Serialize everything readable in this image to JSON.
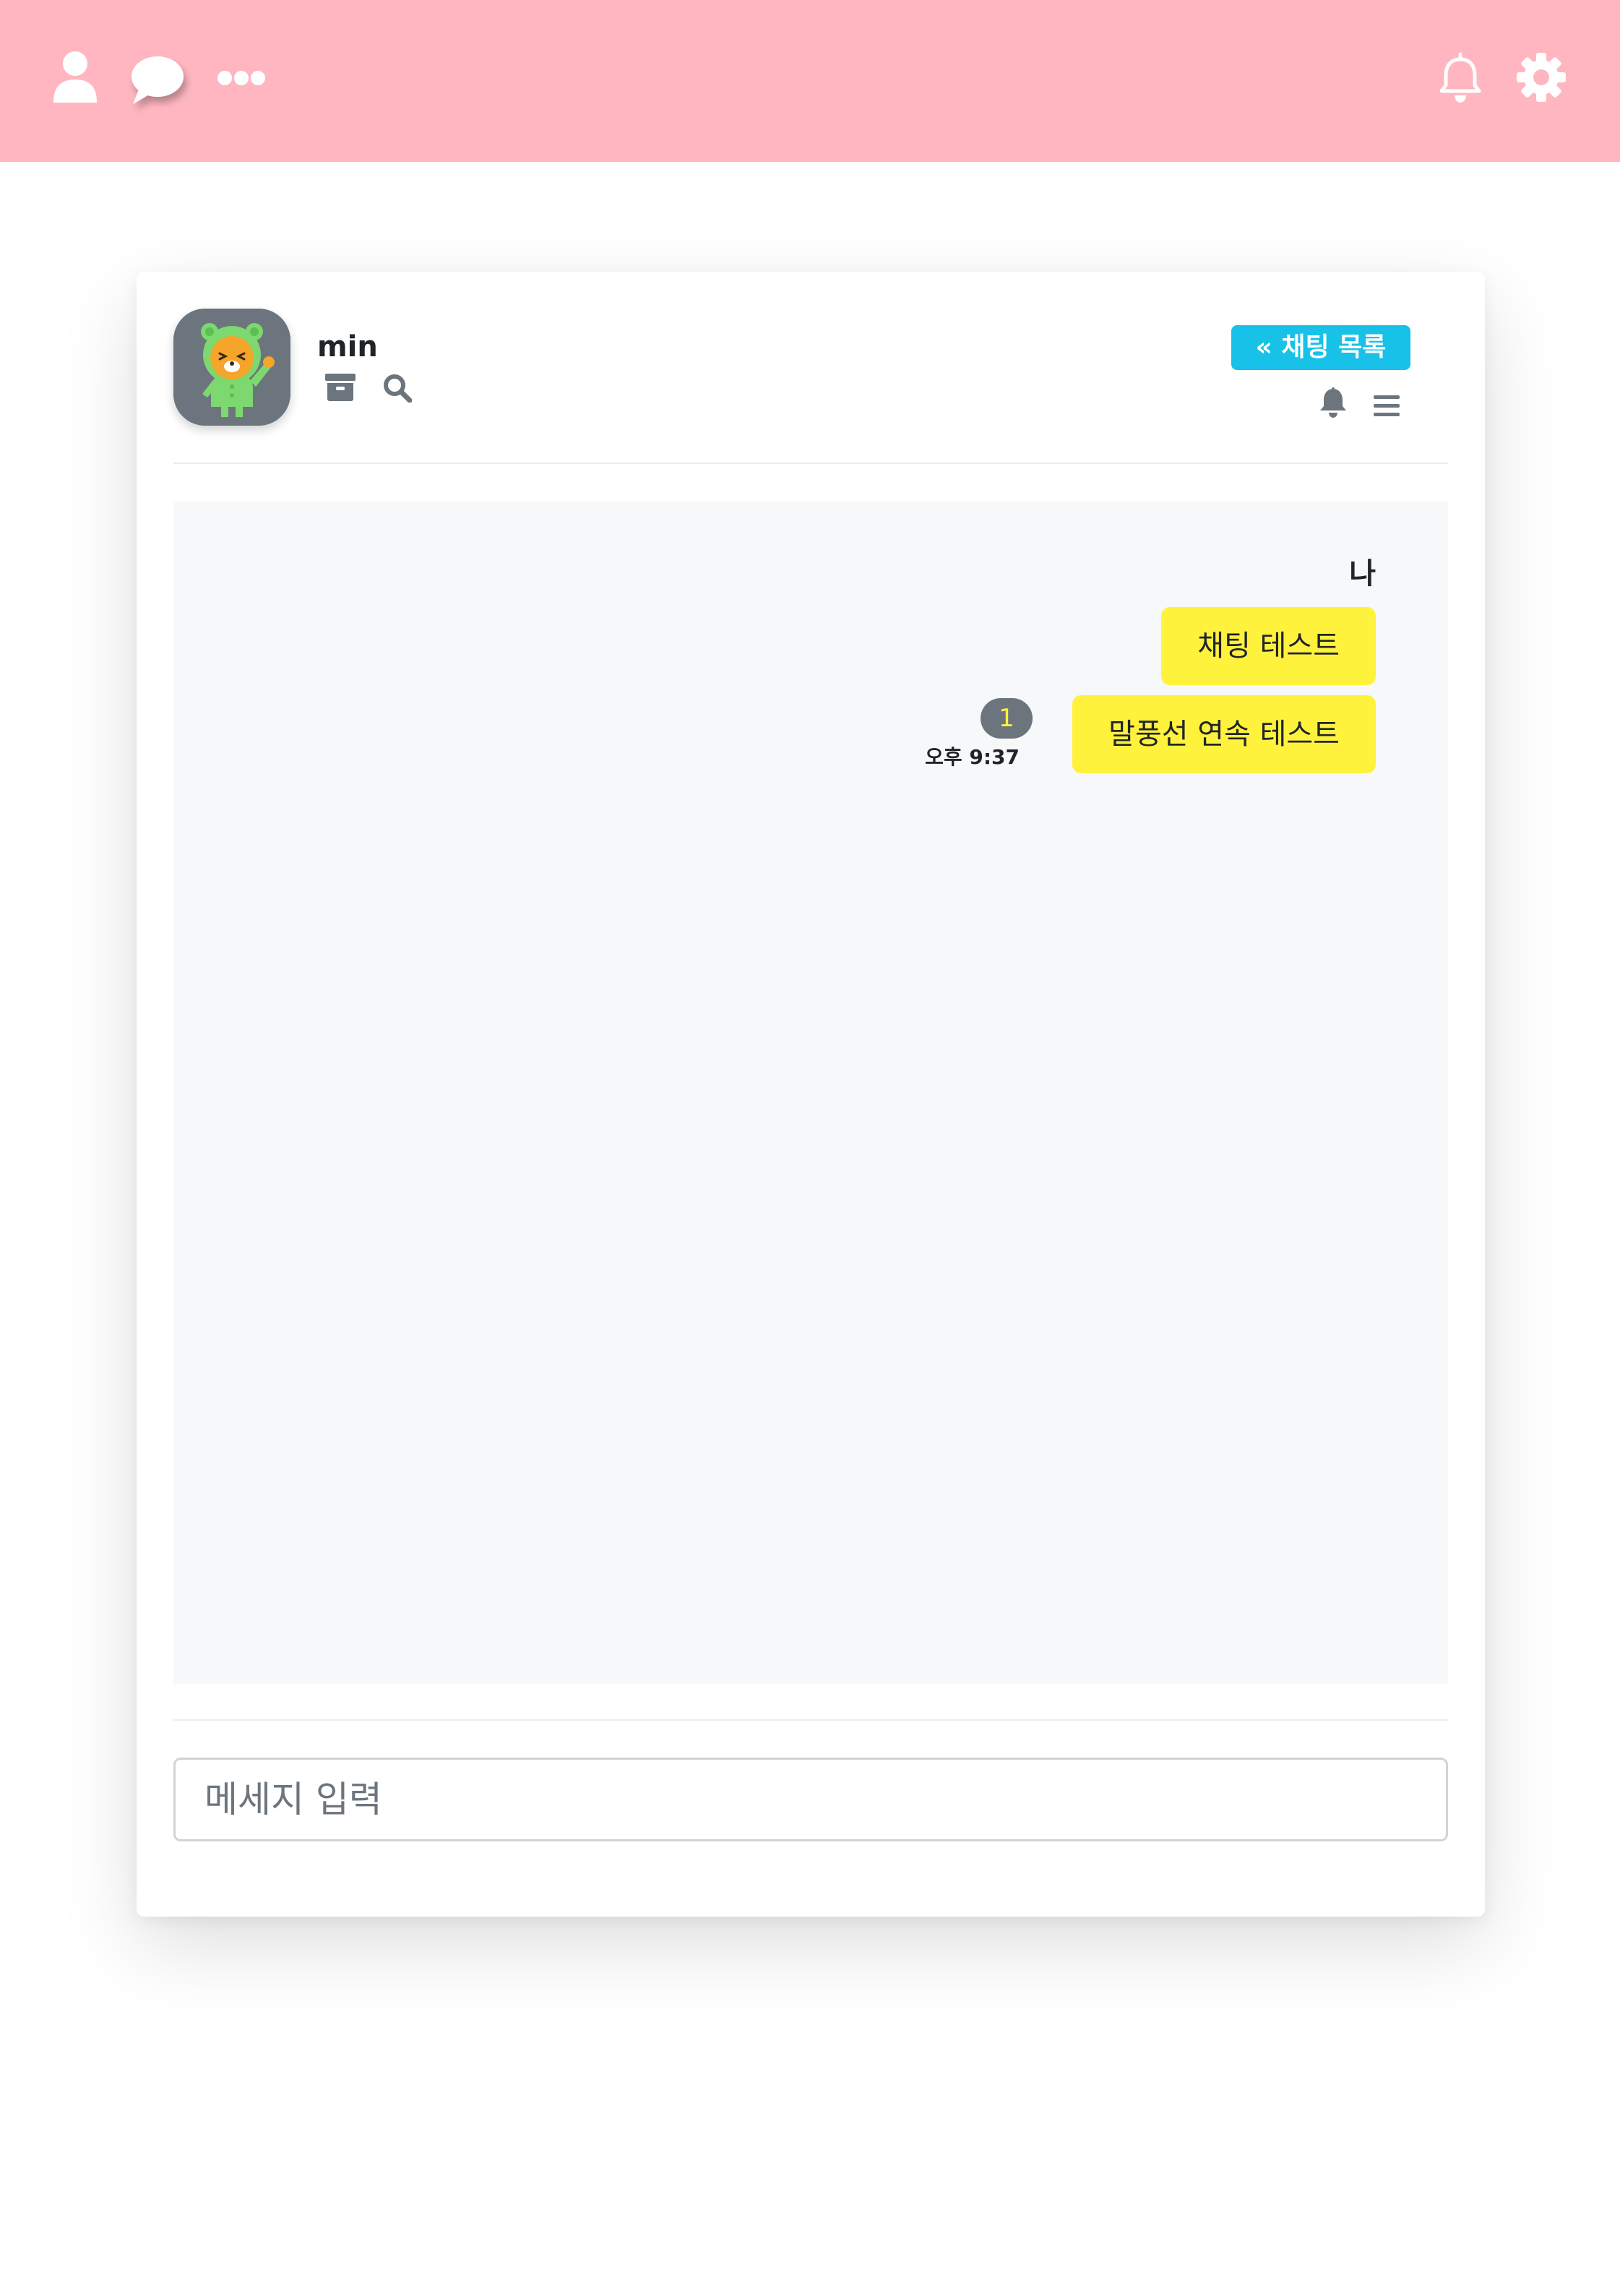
{
  "topbar": {
    "background": "#ffb6c0",
    "left_icons": [
      "user-icon",
      "chat-bubble-icon",
      "more-horizontal-icon"
    ],
    "right_icons": [
      "bell-outline-icon",
      "gear-icon"
    ]
  },
  "chat_header": {
    "name": "min",
    "avatar": "lion-character-in-green-costume",
    "icons": [
      "archive-icon",
      "search-icon"
    ],
    "list_button_label": "« 채팅 목록",
    "right_icons": [
      "bell-icon",
      "menu-icon"
    ]
  },
  "messages": {
    "sender_label": "나",
    "items": [
      {
        "text": "채팅 테스트"
      },
      {
        "text": "말풍선 연속 테스트",
        "unread_count": "1",
        "time": "오후 9:37"
      }
    ]
  },
  "input": {
    "placeholder": "메세지 입력",
    "value": ""
  },
  "colors": {
    "topbar": "#ffb6c0",
    "bubble": "#fff23d",
    "accent_button": "#17c1e8",
    "badge": "#6c757d",
    "message_area": "#f7f8fa"
  }
}
